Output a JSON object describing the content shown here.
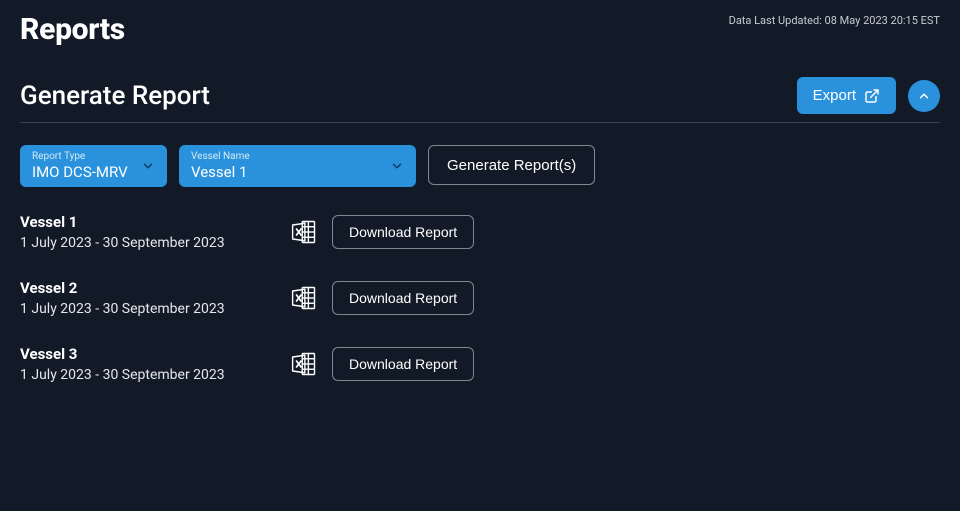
{
  "header": {
    "title": "Reports",
    "last_updated": "Data Last Updated: 08 May 2023 20:15 EST"
  },
  "section": {
    "title": "Generate Report",
    "export_label": "Export"
  },
  "filters": {
    "report_type": {
      "label": "Report Type",
      "value": "IMO DCS-MRV"
    },
    "vessel_name": {
      "label": "Vessel Name",
      "value": "Vessel 1"
    },
    "generate_label": "Generate Report(s)"
  },
  "results": [
    {
      "name": "Vessel 1",
      "date_range": "1 July 2023 - 30 September 2023",
      "download_label": "Download Report"
    },
    {
      "name": "Vessel 2",
      "date_range": "1 July 2023 - 30 September 2023",
      "download_label": "Download Report"
    },
    {
      "name": "Vessel 3",
      "date_range": "1 July 2023 - 30 September 2023",
      "download_label": "Download Report"
    }
  ]
}
